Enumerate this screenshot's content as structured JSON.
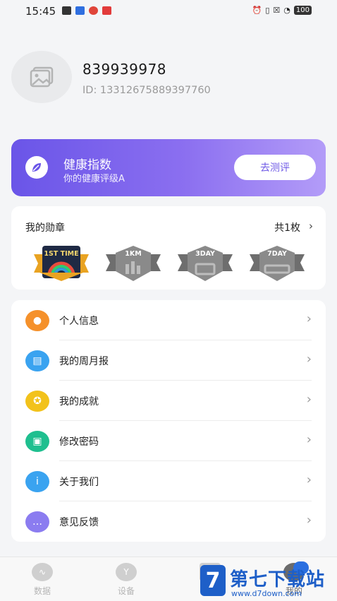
{
  "status_bar": {
    "time": "15:45",
    "battery": "100",
    "left_icon_colors": [
      "#333333",
      "#2f6fe0",
      "#e0453a",
      "#e23b3b"
    ]
  },
  "profile": {
    "username": "839939978",
    "user_id": "ID: 1331267588939776​0"
  },
  "health": {
    "title": "健康指数",
    "subtitle": "你的健康评级A",
    "button": "去测评",
    "gradient_start": "#6a55e8",
    "gradient_end": "#b39cf8"
  },
  "medals": {
    "title": "我的勋章",
    "count": "共1枚",
    "items": [
      {
        "label": "1ST TIME",
        "icon": "first-time-medal-icon",
        "earned": true
      },
      {
        "label": "1KM",
        "icon": "1km-medal-icon",
        "earned": false
      },
      {
        "label": "3DAY",
        "icon": "3day-medal-icon",
        "earned": false
      },
      {
        "label": "7DAY",
        "icon": "7day-medal-icon",
        "earned": false
      }
    ]
  },
  "menu": [
    {
      "label": "个人信息",
      "icon": "user-icon",
      "color": "#f5912b"
    },
    {
      "label": "我的周月报",
      "icon": "report-icon",
      "color": "#3aa3f0"
    },
    {
      "label": "我的成就",
      "icon": "achievement-icon",
      "color": "#f2c21b"
    },
    {
      "label": "修改密码",
      "icon": "lock-icon",
      "color": "#1fbf8f"
    },
    {
      "label": "关于我们",
      "icon": "info-icon",
      "color": "#3aa3f0"
    },
    {
      "label": "意见反馈",
      "icon": "feedback-icon",
      "color": "#8b7cf0"
    }
  ],
  "tabs": [
    {
      "label": "数据",
      "icon": "data-icon",
      "active": false
    },
    {
      "label": "设备",
      "icon": "device-icon",
      "active": false
    },
    {
      "label": "",
      "icon": "center-icon",
      "active": false
    },
    {
      "label": "我的",
      "icon": "profile-icon",
      "active": true
    }
  ],
  "watermark": {
    "logo": "7",
    "title": "第七下载站",
    "url": "www.d7down.com"
  }
}
